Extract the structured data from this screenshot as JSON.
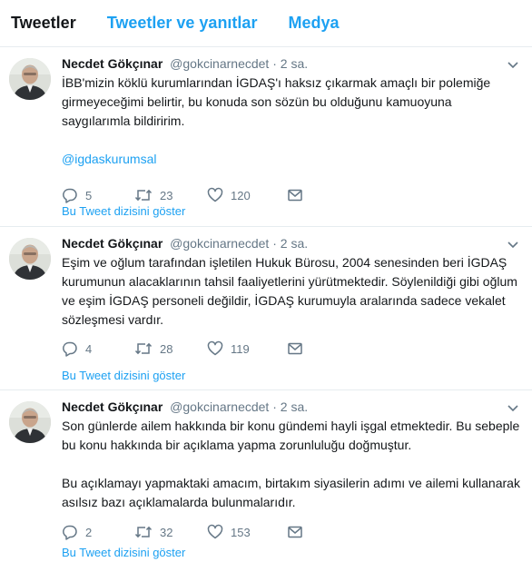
{
  "tabs": [
    {
      "label": "Tweetler"
    },
    {
      "label": "Tweetler ve yanıtlar"
    },
    {
      "label": "Medya"
    }
  ],
  "tweets": [
    {
      "name": "Necdet Gökçınar",
      "handle": "@gokcinarnecdet",
      "separator": "·",
      "time": "2 sa.",
      "paragraphs": [
        "İBB'mizin köklü kurumlarından İGDAŞ'ı haksız çıkarmak amaçlı bir polemiğe girmeyeceğimi belirtir, bu konuda son sözün bu olduğunu kamuoyuna saygılarımla bildiririm."
      ],
      "mention": "@igdaskurumsal",
      "replies": "5",
      "retweets": "23",
      "likes": "120",
      "thread_label": "Bu Tweet dizisini göster"
    },
    {
      "name": "Necdet Gökçınar",
      "handle": "@gokcinarnecdet",
      "separator": "·",
      "time": "2 sa.",
      "paragraphs": [
        "Eşim ve oğlum tarafından işletilen Hukuk Bürosu, 2004 senesinden beri İGDAŞ kurumunun alacaklarının tahsil faaliyetlerini yürütmektedir. Söylenildiği gibi oğlum ve eşim İGDAŞ personeli değildir, İGDAŞ kurumuyla aralarında sadece vekalet sözleşmesi vardır."
      ],
      "replies": "4",
      "retweets": "28",
      "likes": "119",
      "thread_label": "Bu Tweet dizisini göster"
    },
    {
      "name": "Necdet Gökçınar",
      "handle": "@gokcinarnecdet",
      "separator": "·",
      "time": "2 sa.",
      "paragraphs": [
        "Son günlerde ailem hakkında bir konu gündemi hayli işgal etmektedir. Bu sebeple bu konu hakkında bir açıklama yapma zorunluluğu doğmuştur.",
        "Bu açıklamayı yapmaktaki amacım, birtakım siyasilerin adımı ve ailemi kullanarak asılsız bazı açıklamalarda bulunmalarıdır."
      ],
      "replies": "2",
      "retweets": "32",
      "likes": "153",
      "thread_label": "Bu Tweet dizisini göster"
    }
  ],
  "icons": {
    "avatar": "avatar-photo",
    "caret": "chevron-down-icon",
    "reply": "reply-icon",
    "retweet": "retweet-icon",
    "like": "heart-icon",
    "dm": "envelope-icon"
  },
  "colors": {
    "accent": "#1da1f2",
    "text": "#14171a",
    "muted": "#657786",
    "border": "#e6ecf0"
  }
}
